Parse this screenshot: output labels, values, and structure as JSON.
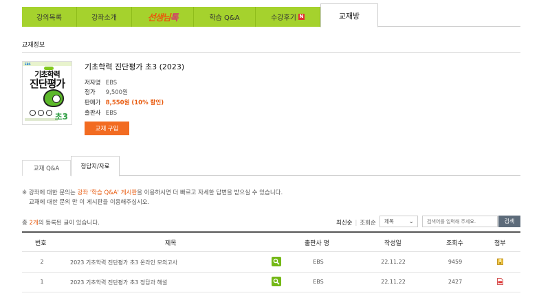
{
  "tabs": [
    {
      "label": "강의목록"
    },
    {
      "label": "강좌소개"
    },
    {
      "label_a": "선생님",
      "label_b": "톡"
    },
    {
      "label": "학습 Q&A"
    },
    {
      "label": "수강후기",
      "badge": "N"
    },
    {
      "label": "교재방"
    }
  ],
  "section_title": "교재정보",
  "book": {
    "cover": {
      "tag": "EBS",
      "line1": "기초학력",
      "line2": "진단평가",
      "grade": "초3"
    },
    "title": "기초학력 진단평가 초3 (2023)",
    "author_label": "저자명",
    "author": "EBS",
    "price_label": "정가",
    "price": "9,500원",
    "sale_label": "판매가",
    "sale": "8,550원 (10% 할인)",
    "publisher_label": "출판사",
    "publisher": "EBS",
    "buy_label": "교재 구입"
  },
  "subtabs": [
    "교재 Q&A",
    "정답지/자료"
  ],
  "notice": {
    "pre": "※ 강좌에 대한 문의는 ",
    "highlight": "강좌 '학습 Q&A' 게시판",
    "post": "을 이용하시면 더 빠르고 자세한 답변을 받으실 수 있습니다.",
    "line2": "교재에 대한 문의 만 이 게시판을 이용해주십시오."
  },
  "board": {
    "total_pre": "총 ",
    "total_count": "2개",
    "total_post": "의 등록된 글이 있습니다.",
    "sort_latest": "최신순",
    "sort_views": "조회순",
    "select_value": "제목",
    "search_placeholder": "검색어를 입력해 주세요.",
    "search_button": "검색",
    "headers": {
      "no": "번호",
      "title": "제목",
      "publisher": "출판사 명",
      "date": "작성일",
      "views": "조회수",
      "attach": "첨부"
    },
    "rows": [
      {
        "no": "2",
        "title": "2023 기초학력 진단평가 초3 온라인 모의고사",
        "publisher": "EBS",
        "date": "22.11.22",
        "views": "9459",
        "attach_icon": "zip-file-icon"
      },
      {
        "no": "1",
        "title": "2023 기초학력 진단평가 초3 정답과 해설",
        "publisher": "EBS",
        "date": "22.11.22",
        "views": "2427",
        "attach_icon": "pdf-file-icon"
      }
    ]
  },
  "colors": {
    "tab_green": "#a5d22d",
    "accent_orange": "#f26b21",
    "search_btn": "#5d6b7a",
    "preview_green": "#74b816"
  }
}
